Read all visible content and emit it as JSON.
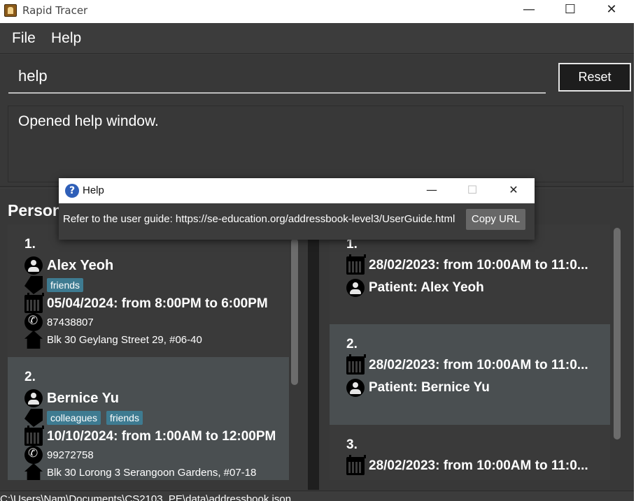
{
  "window": {
    "title": "Rapid Tracer",
    "minimize": "—",
    "maximize": "☐",
    "close": "✕"
  },
  "menu": {
    "file": "File",
    "help": "Help"
  },
  "command": {
    "value": "help",
    "reset_label": "Reset"
  },
  "result": {
    "text": "Opened help window."
  },
  "persons_title": "Persons",
  "persons": [
    {
      "index": "1.",
      "name": "Alex Yeoh",
      "tags": [
        "friends"
      ],
      "appointment": "05/04/2024: from 8:00PM to 6:00PM",
      "phone": "87438807",
      "address": "Blk 30 Geylang Street 29, #06-40"
    },
    {
      "index": "2.",
      "name": "Bernice Yu",
      "tags": [
        "colleagues",
        "friends"
      ],
      "appointment": "10/10/2024: from 1:00AM to 12:00PM",
      "phone": "99272758",
      "address": "Blk 30 Lorong 3 Serangoon Gardens, #07-18"
    }
  ],
  "appointments": [
    {
      "index": "1.",
      "time": "28/02/2023: from 10:00AM to 11:0...",
      "patient": "Patient: Alex Yeoh"
    },
    {
      "index": "2.",
      "time": "28/02/2023: from 10:00AM to 11:0...",
      "patient": "Patient: Bernice Yu"
    },
    {
      "index": "3.",
      "time": "28/02/2023: from 10:00AM to 11:0...",
      "patient": ""
    }
  ],
  "status": {
    "path": "C:\\Users\\Nam\\Documents\\CS2103_PE\\data\\addressbook.json"
  },
  "help_dialog": {
    "title": "Help",
    "icon": "?",
    "message": "Refer to the user guide: https://se-education.org/addressbook-level3/UserGuide.html",
    "copy_label": "Copy URL",
    "minimize": "—",
    "maximize": "☐",
    "close": "✕"
  }
}
